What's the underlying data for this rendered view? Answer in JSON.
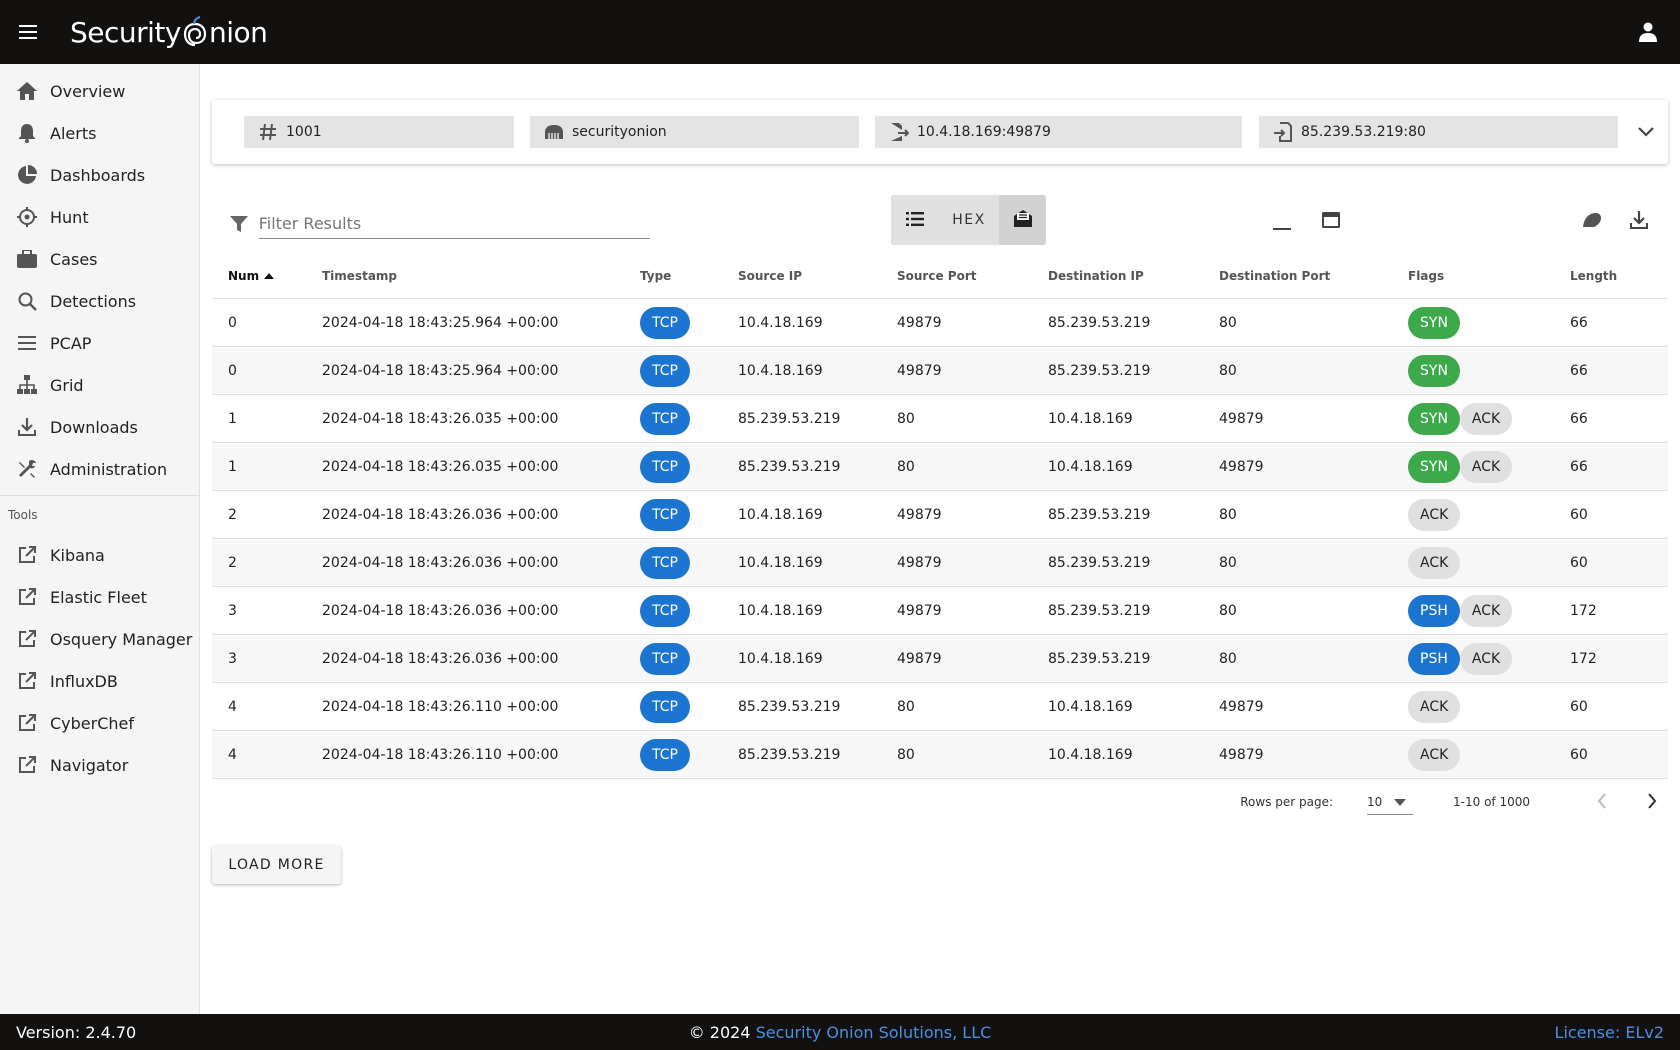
{
  "header": {
    "logo_part1": "Security",
    "logo_part2": "nion",
    "menu_icon": "hamburger-menu-icon",
    "user_icon": "account-icon"
  },
  "sidebar": {
    "items": [
      {
        "label": "Overview",
        "icon": "home-icon"
      },
      {
        "label": "Alerts",
        "icon": "bell-icon"
      },
      {
        "label": "Dashboards",
        "icon": "pie-chart-icon"
      },
      {
        "label": "Hunt",
        "icon": "crosshairs-icon"
      },
      {
        "label": "Cases",
        "icon": "briefcase-icon"
      },
      {
        "label": "Detections",
        "icon": "search-icon"
      },
      {
        "label": "PCAP",
        "icon": "lines-icon"
      },
      {
        "label": "Grid",
        "icon": "network-icon"
      },
      {
        "label": "Downloads",
        "icon": "download-icon"
      },
      {
        "label": "Administration",
        "icon": "tools-icon"
      }
    ],
    "tools_header": "Tools",
    "tools": [
      {
        "label": "Kibana",
        "icon": "external-link-icon"
      },
      {
        "label": "Elastic Fleet",
        "icon": "external-link-icon"
      },
      {
        "label": "Osquery Manager",
        "icon": "external-link-icon"
      },
      {
        "label": "InfluxDB",
        "icon": "external-link-icon"
      },
      {
        "label": "CyberChef",
        "icon": "external-link-icon"
      },
      {
        "label": "Navigator",
        "icon": "external-link-icon"
      }
    ]
  },
  "filters": {
    "id": "1001",
    "sensor": "securityonion",
    "source": "10.4.18.169:49879",
    "destination": "85.239.53.219:80"
  },
  "filter_results": {
    "placeholder": "Filter Results"
  },
  "view_toggle": {
    "hex_label": "HEX"
  },
  "table": {
    "headers": [
      "Num",
      "Timestamp",
      "Type",
      "Source IP",
      "Source Port",
      "Destination IP",
      "Destination Port",
      "Flags",
      "Length"
    ],
    "rows": [
      {
        "num": "0",
        "ts": "2024-04-18 18:43:25.964 +00:00",
        "type": "TCP",
        "src": "10.4.18.169",
        "sport": "49879",
        "dst": "85.239.53.219",
        "dport": "80",
        "flags": [
          "SYN"
        ],
        "len": "66"
      },
      {
        "num": "0",
        "ts": "2024-04-18 18:43:25.964 +00:00",
        "type": "TCP",
        "src": "10.4.18.169",
        "sport": "49879",
        "dst": "85.239.53.219",
        "dport": "80",
        "flags": [
          "SYN"
        ],
        "len": "66"
      },
      {
        "num": "1",
        "ts": "2024-04-18 18:43:26.035 +00:00",
        "type": "TCP",
        "src": "85.239.53.219",
        "sport": "80",
        "dst": "10.4.18.169",
        "dport": "49879",
        "flags": [
          "SYN",
          "ACK"
        ],
        "len": "66"
      },
      {
        "num": "1",
        "ts": "2024-04-18 18:43:26.035 +00:00",
        "type": "TCP",
        "src": "85.239.53.219",
        "sport": "80",
        "dst": "10.4.18.169",
        "dport": "49879",
        "flags": [
          "SYN",
          "ACK"
        ],
        "len": "66"
      },
      {
        "num": "2",
        "ts": "2024-04-18 18:43:26.036 +00:00",
        "type": "TCP",
        "src": "10.4.18.169",
        "sport": "49879",
        "dst": "85.239.53.219",
        "dport": "80",
        "flags": [
          "ACK"
        ],
        "len": "60"
      },
      {
        "num": "2",
        "ts": "2024-04-18 18:43:26.036 +00:00",
        "type": "TCP",
        "src": "10.4.18.169",
        "sport": "49879",
        "dst": "85.239.53.219",
        "dport": "80",
        "flags": [
          "ACK"
        ],
        "len": "60"
      },
      {
        "num": "3",
        "ts": "2024-04-18 18:43:26.036 +00:00",
        "type": "TCP",
        "src": "10.4.18.169",
        "sport": "49879",
        "dst": "85.239.53.219",
        "dport": "80",
        "flags": [
          "PSH",
          "ACK"
        ],
        "len": "172"
      },
      {
        "num": "3",
        "ts": "2024-04-18 18:43:26.036 +00:00",
        "type": "TCP",
        "src": "10.4.18.169",
        "sport": "49879",
        "dst": "85.239.53.219",
        "dport": "80",
        "flags": [
          "PSH",
          "ACK"
        ],
        "len": "172"
      },
      {
        "num": "4",
        "ts": "2024-04-18 18:43:26.110 +00:00",
        "type": "TCP",
        "src": "85.239.53.219",
        "sport": "80",
        "dst": "10.4.18.169",
        "dport": "49879",
        "flags": [
          "ACK"
        ],
        "len": "60"
      },
      {
        "num": "4",
        "ts": "2024-04-18 18:43:26.110 +00:00",
        "type": "TCP",
        "src": "85.239.53.219",
        "sport": "80",
        "dst": "10.4.18.169",
        "dport": "49879",
        "flags": [
          "ACK"
        ],
        "len": "60"
      }
    ]
  },
  "pagination": {
    "rows_per_page_label": "Rows per page:",
    "rows_per_page_value": "10",
    "range": "1-10 of 1000"
  },
  "load_more_label": "LOAD MORE",
  "footer": {
    "version": "Version: 2.4.70",
    "copyright_prefix": "© 2024 ",
    "company": "Security Onion Solutions, LLC",
    "license": "License: ELv2"
  },
  "colors": {
    "topbar": "#121110",
    "tcp_chip": "#1c74d1",
    "syn_chip": "#3da94a",
    "ack_chip": "#e0e0e0",
    "link": "#4a90e2"
  }
}
